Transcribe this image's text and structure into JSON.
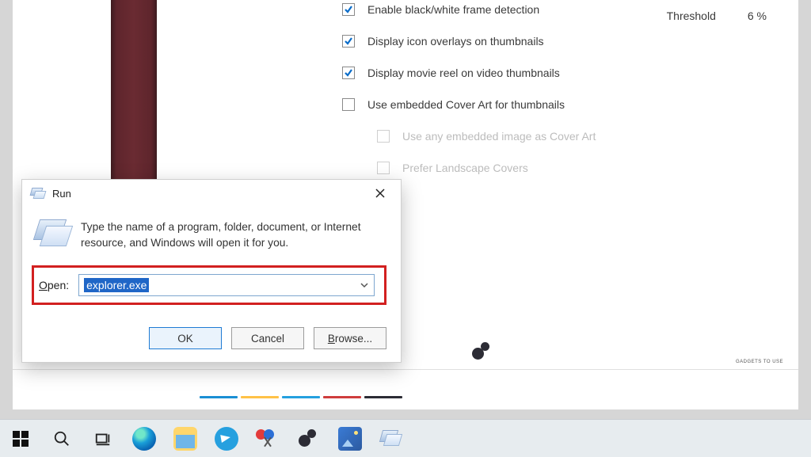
{
  "settings": {
    "rows": [
      {
        "label": "Enable black/white frame detection",
        "checked": true,
        "dim": false
      },
      {
        "label": "Display icon overlays on thumbnails",
        "checked": true,
        "dim": false
      },
      {
        "label": "Display movie reel on video thumbnails",
        "checked": true,
        "dim": false
      },
      {
        "label": "Use embedded Cover Art for thumbnails",
        "checked": false,
        "dim": false
      },
      {
        "label": "Use any embedded image as Cover Art",
        "checked": false,
        "dim": true
      },
      {
        "label": "Prefer Landscape Covers",
        "checked": false,
        "dim": true
      }
    ],
    "threshold_label": "Threshold",
    "threshold_value": "6 %"
  },
  "run": {
    "title": "Run",
    "description": "Type the name of a program, folder, document, or Internet resource, and Windows will open it for you.",
    "open_label_underline": "O",
    "open_label_rest": "pen:",
    "input_value": "explorer.exe",
    "buttons": {
      "ok": "OK",
      "cancel": "Cancel",
      "browse_underline": "B",
      "browse_rest": "rowse..."
    }
  },
  "taskbar": {
    "items": [
      "start",
      "search",
      "task-view",
      "edge",
      "file-explorer",
      "telegram",
      "snip-sketch",
      "steam",
      "photos",
      "run"
    ]
  },
  "watermark": "GADGETS TO USE"
}
